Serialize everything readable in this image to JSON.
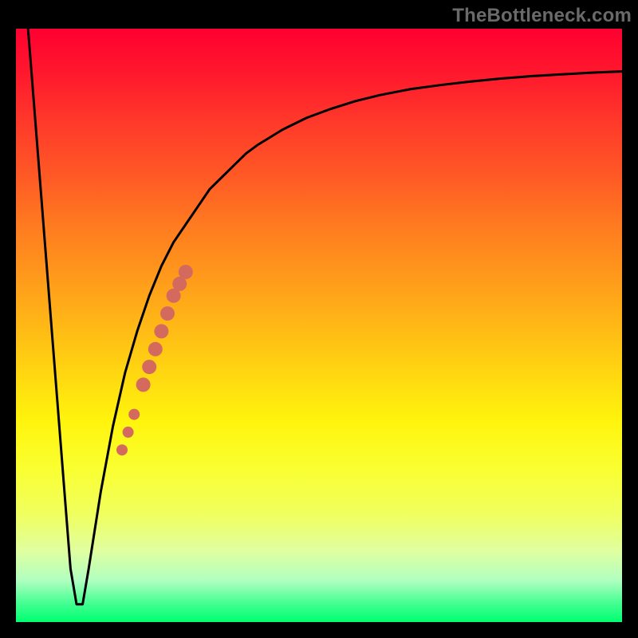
{
  "watermark": "TheBottleneck.com",
  "chart_data": {
    "type": "line",
    "title": "",
    "xlabel": "",
    "ylabel": "",
    "xlim": [
      0,
      100
    ],
    "ylim": [
      0,
      100
    ],
    "grid": false,
    "series": [
      {
        "name": "curve",
        "x": [
          2,
          4,
          6,
          8,
          9,
          10,
          11,
          12,
          14,
          16,
          18,
          20,
          22,
          24,
          26,
          28,
          30,
          32,
          34,
          36,
          38,
          40,
          44,
          48,
          52,
          56,
          60,
          65,
          70,
          75,
          80,
          85,
          90,
          95,
          100
        ],
        "y": [
          100,
          74,
          48,
          22,
          9,
          3,
          3,
          9,
          22,
          33,
          42,
          49,
          55,
          60,
          64,
          67,
          70,
          73,
          75,
          77,
          79,
          80.5,
          83,
          85,
          86.5,
          87.8,
          88.8,
          89.8,
          90.5,
          91.1,
          91.6,
          92,
          92.3,
          92.6,
          92.8
        ]
      }
    ],
    "highlight_points": {
      "name": "data-points",
      "color": "#d46a5e",
      "points": [
        {
          "x": 17.5,
          "y": 29
        },
        {
          "x": 18.5,
          "y": 32
        },
        {
          "x": 19.5,
          "y": 35
        },
        {
          "x": 21.0,
          "y": 40
        },
        {
          "x": 22.0,
          "y": 43
        },
        {
          "x": 23.0,
          "y": 46
        },
        {
          "x": 24.0,
          "y": 49
        },
        {
          "x": 25.0,
          "y": 52
        },
        {
          "x": 26.0,
          "y": 55
        },
        {
          "x": 27.0,
          "y": 57
        },
        {
          "x": 28.0,
          "y": 59
        }
      ]
    },
    "colors": {
      "gradient_top": "#ff0030",
      "gradient_mid": "#ffd000",
      "gradient_bottom": "#00ff70",
      "curve": "#000000",
      "frame": "#000000"
    }
  }
}
